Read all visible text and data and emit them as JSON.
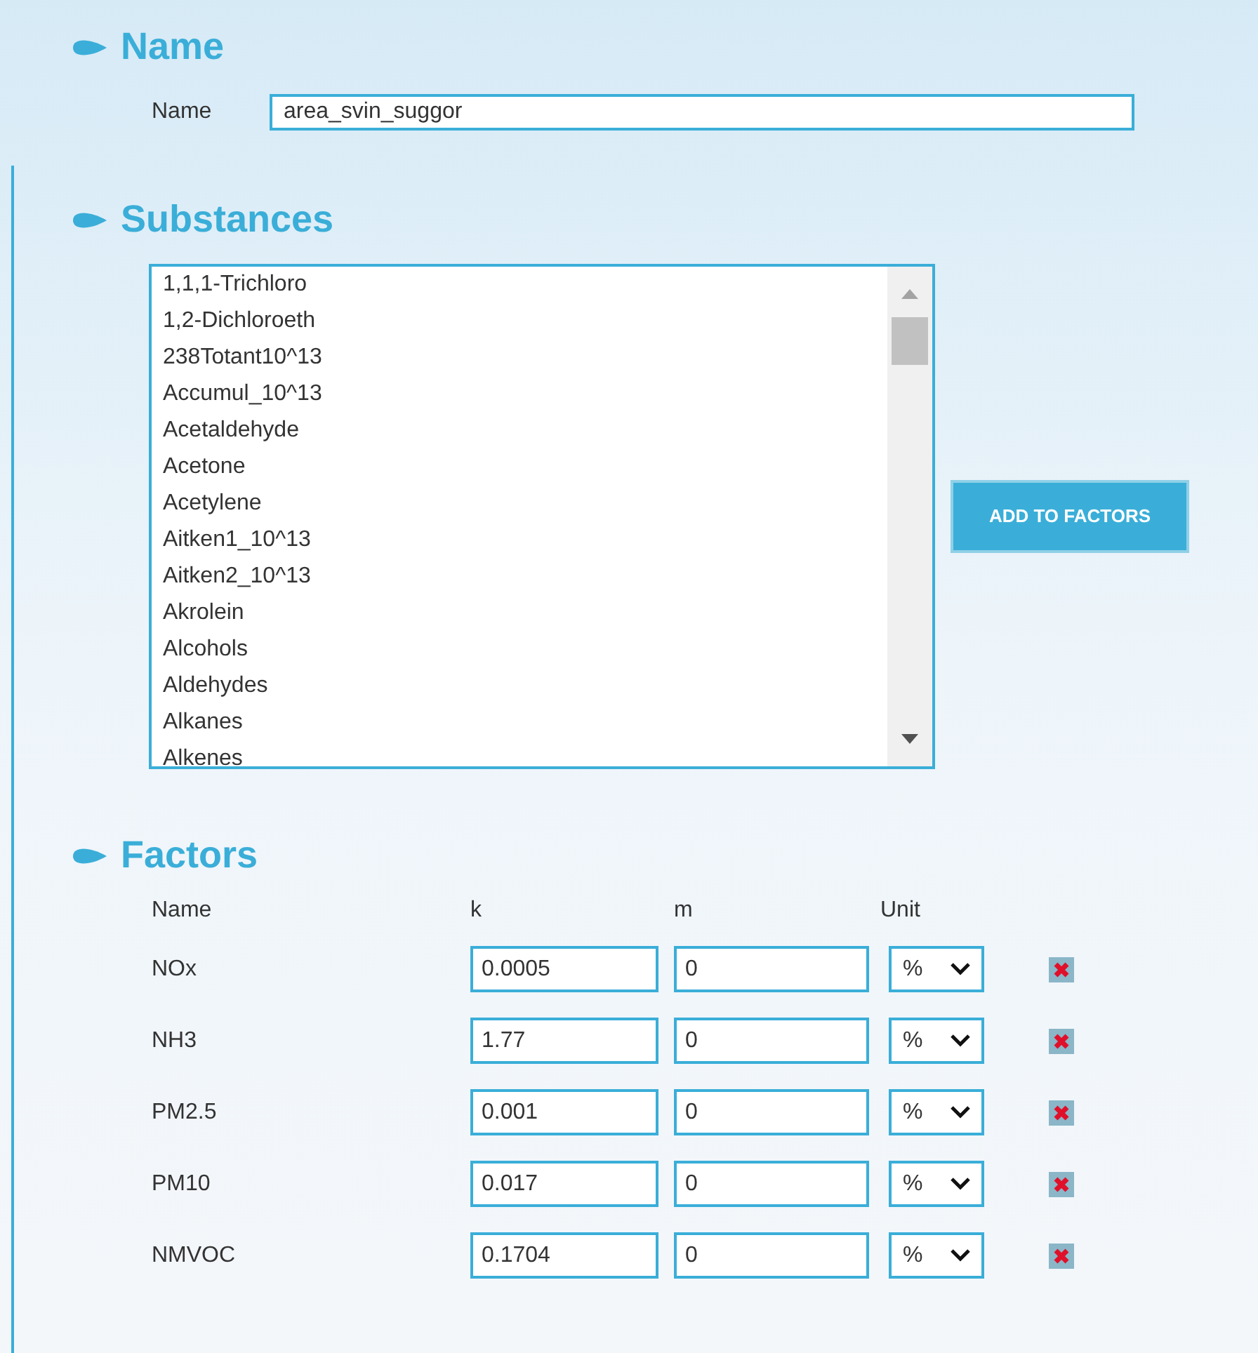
{
  "name_section": {
    "heading": "Name",
    "label": "Name",
    "value": "area_svin_suggor"
  },
  "substances_section": {
    "heading": "Substances",
    "items": [
      {
        "label": "1,1,1-Trichloro",
        "selected": false
      },
      {
        "label": "1,2-Dichloroeth",
        "selected": false
      },
      {
        "label": "238Totant10^13",
        "selected": false
      },
      {
        "label": "Accumul_10^13",
        "selected": false
      },
      {
        "label": "Acetaldehyde",
        "selected": false
      },
      {
        "label": "Acetone",
        "selected": false
      },
      {
        "label": "Acetylene",
        "selected": false
      },
      {
        "label": "Aitken1_10^13",
        "selected": false
      },
      {
        "label": "Aitken2_10^13",
        "selected": false
      },
      {
        "label": "Akrolein",
        "selected": false
      },
      {
        "label": "Alcohols",
        "selected": false
      },
      {
        "label": "Aldehydes",
        "selected": false
      },
      {
        "label": "Alkanes",
        "selected": false
      },
      {
        "label": "Alkenes",
        "selected": false
      }
    ],
    "button": "ADD TO FACTORS"
  },
  "factors_section": {
    "heading": "Factors",
    "columns": [
      "Name",
      "k",
      "m",
      "Unit"
    ],
    "rows": [
      {
        "name": "NOx",
        "k": "0.0005",
        "m": "0",
        "unit": "%"
      },
      {
        "name": "NH3",
        "k": "1.77",
        "m": "0",
        "unit": "%"
      },
      {
        "name": "PM2.5",
        "k": "0.001",
        "m": "0",
        "unit": "%"
      },
      {
        "name": "PM10",
        "k": "0.017",
        "m": "0",
        "unit": "%"
      },
      {
        "name": "NMVOC",
        "k": "0.1704",
        "m": "0",
        "unit": "%"
      }
    ]
  }
}
